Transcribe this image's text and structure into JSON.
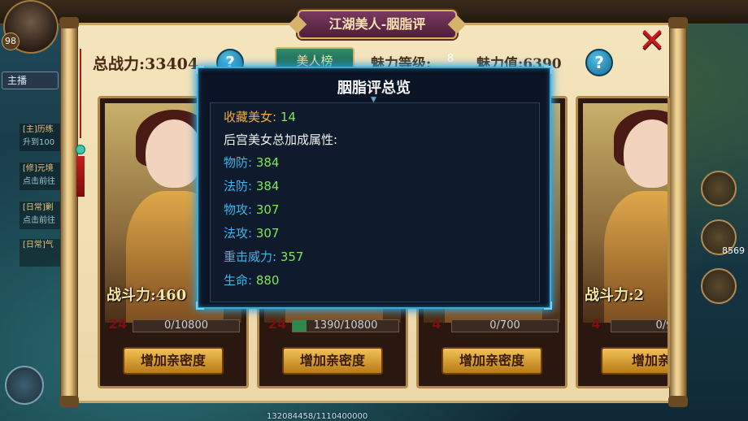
{
  "panel": {
    "title": "江湖美人-胭脂评",
    "close_icon": "✕",
    "total_power_label": "总战力:",
    "total_power_value": "33404",
    "tab_label": "美人榜",
    "charm_level_label": "魅力等级:",
    "charm_level_value": "8",
    "charm_value_label": "魅力值:",
    "charm_value": "6390",
    "help_icon": "?"
  },
  "cards": [
    {
      "power_label": "战斗力:",
      "power_value": "460",
      "heart_value": "24",
      "progress_text": "0/10800",
      "progress_fraction": 0.0,
      "button_label": "增加亲密度"
    },
    {
      "power_label": "",
      "power_value": "",
      "heart_value": "24",
      "progress_text": "1390/10800",
      "progress_fraction": 0.13,
      "button_label": "增加亲密度"
    },
    {
      "power_label": "",
      "power_value": "",
      "heart_value": "4",
      "progress_text": "0/700",
      "progress_fraction": 0.0,
      "button_label": "增加亲密度"
    },
    {
      "power_label": "战斗力:",
      "power_value": "2",
      "heart_value": "4",
      "progress_text": "0/9",
      "progress_fraction": 0.0,
      "button_label": "增加亲"
    }
  ],
  "background": {
    "level": "98",
    "dropdown": "主播",
    "quests": [
      {
        "tag": "[主]历练",
        "desc": "升到100"
      },
      {
        "tag": "[修]元境",
        "desc": "点击前往"
      },
      {
        "tag": "[日常]剿",
        "desc": "点击前往"
      },
      {
        "tag": "[日常]气",
        "desc": ""
      }
    ],
    "item_count": "8569",
    "bottom_text": "132084458/1110400000"
  },
  "modal": {
    "title": "胭脂评总览",
    "collected_label": "收藏美女:",
    "collected_value": "14",
    "bonus_heading": "后宫美女总加成属性:",
    "stats": [
      {
        "label": "物防:",
        "value": "384"
      },
      {
        "label": "法防:",
        "value": "384"
      },
      {
        "label": "物攻:",
        "value": "307"
      },
      {
        "label": "法攻:",
        "value": "307"
      },
      {
        "label": "重击威力:",
        "value": "357"
      },
      {
        "label": "生命:",
        "value": "880"
      }
    ]
  },
  "colors": {
    "modal_border": "#3fa9d4",
    "stat_label": "#3fb6e8",
    "stat_value": "#7ee65a",
    "collected_label": "#f0b03a",
    "panel_bg": "#f4e4bd",
    "button_gold": "#f2c254"
  }
}
